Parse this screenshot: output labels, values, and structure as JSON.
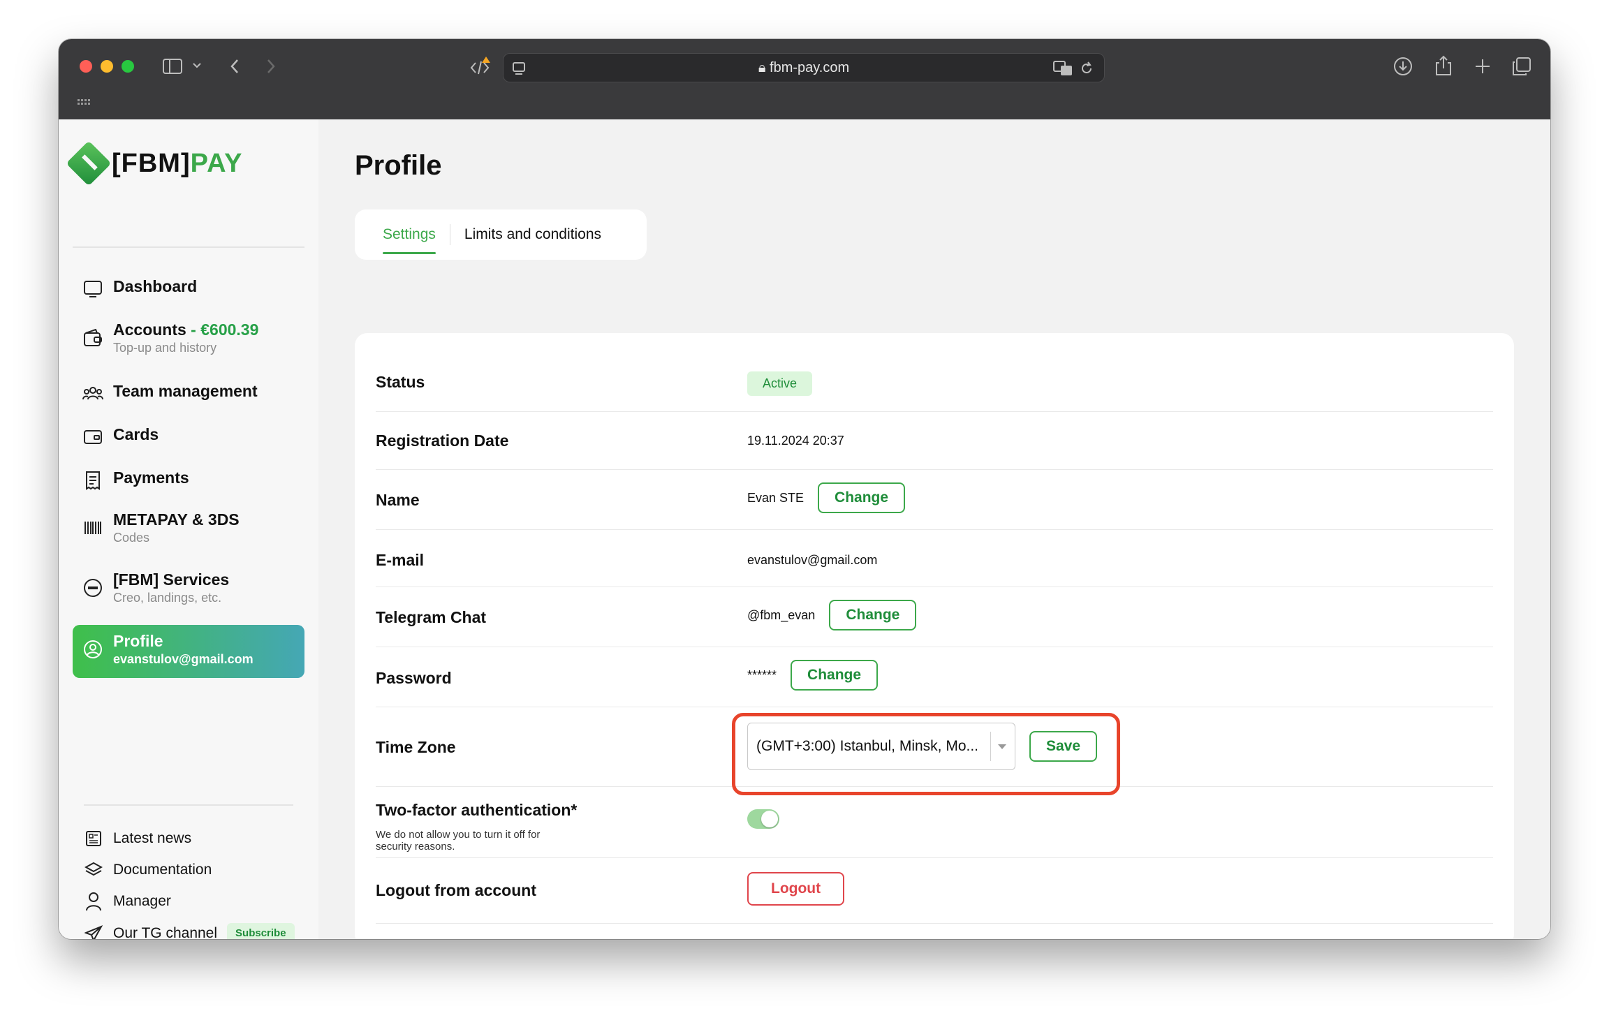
{
  "browser": {
    "url": "fbm-pay.com"
  },
  "brand": {
    "name_prefix": "[FBM]",
    "name_suffix": "PAY",
    "accent": "#3ca84a"
  },
  "sidebar": {
    "items": [
      {
        "label": "Dashboard",
        "sub": "",
        "icon": "monitor-icon"
      },
      {
        "label": "Accounts",
        "amount": " - €600.39",
        "sub": "Top-up and history",
        "icon": "wallet-icon"
      },
      {
        "label": "Team management",
        "sub": "",
        "icon": "team-icon"
      },
      {
        "label": "Cards",
        "sub": "",
        "icon": "card-icon"
      },
      {
        "label": "Payments",
        "sub": "",
        "icon": "receipt-icon"
      },
      {
        "label": "METAPAY & 3DS",
        "sub": "Codes",
        "icon": "barcode-icon"
      },
      {
        "label": "[FBM] Services",
        "sub": "Creo, landings, etc.",
        "icon": "fbm-icon"
      },
      {
        "label": "Profile",
        "sub": "evanstulov@gmail.com",
        "icon": "user-circle-icon"
      }
    ],
    "footer": [
      {
        "label": "Latest news",
        "icon": "news-icon"
      },
      {
        "label": "Documentation",
        "icon": "layers-icon"
      },
      {
        "label": "Manager",
        "icon": "person-icon"
      },
      {
        "label": "Our TG channel",
        "icon": "send-icon",
        "badge": "Subscribe"
      }
    ]
  },
  "page": {
    "title": "Profile",
    "tabs": [
      "Settings",
      "Limits and conditions"
    ]
  },
  "profile": {
    "status_label": "Status",
    "status_value": "Active",
    "reg_label": "Registration Date",
    "reg_value": "19.11.2024 20:37",
    "name_label": "Name",
    "name_value": "Evan STE",
    "email_label": "E-mail",
    "email_value": "evanstulov@gmail.com",
    "tg_label": "Telegram Chat",
    "tg_value": "@fbm_evan",
    "pw_label": "Password",
    "pw_value": "******",
    "change_label": "Change",
    "tz_label": "Time Zone",
    "tz_value": "(GMT+3:00) Istanbul, Minsk, Mo...",
    "save_label": "Save",
    "twofa_label": "Two-factor authentication*",
    "twofa_note": "We do not allow you to turn it off for security reasons.",
    "twofa_enabled": true,
    "logout_label": "Logout from account",
    "logout_button": "Logout"
  }
}
